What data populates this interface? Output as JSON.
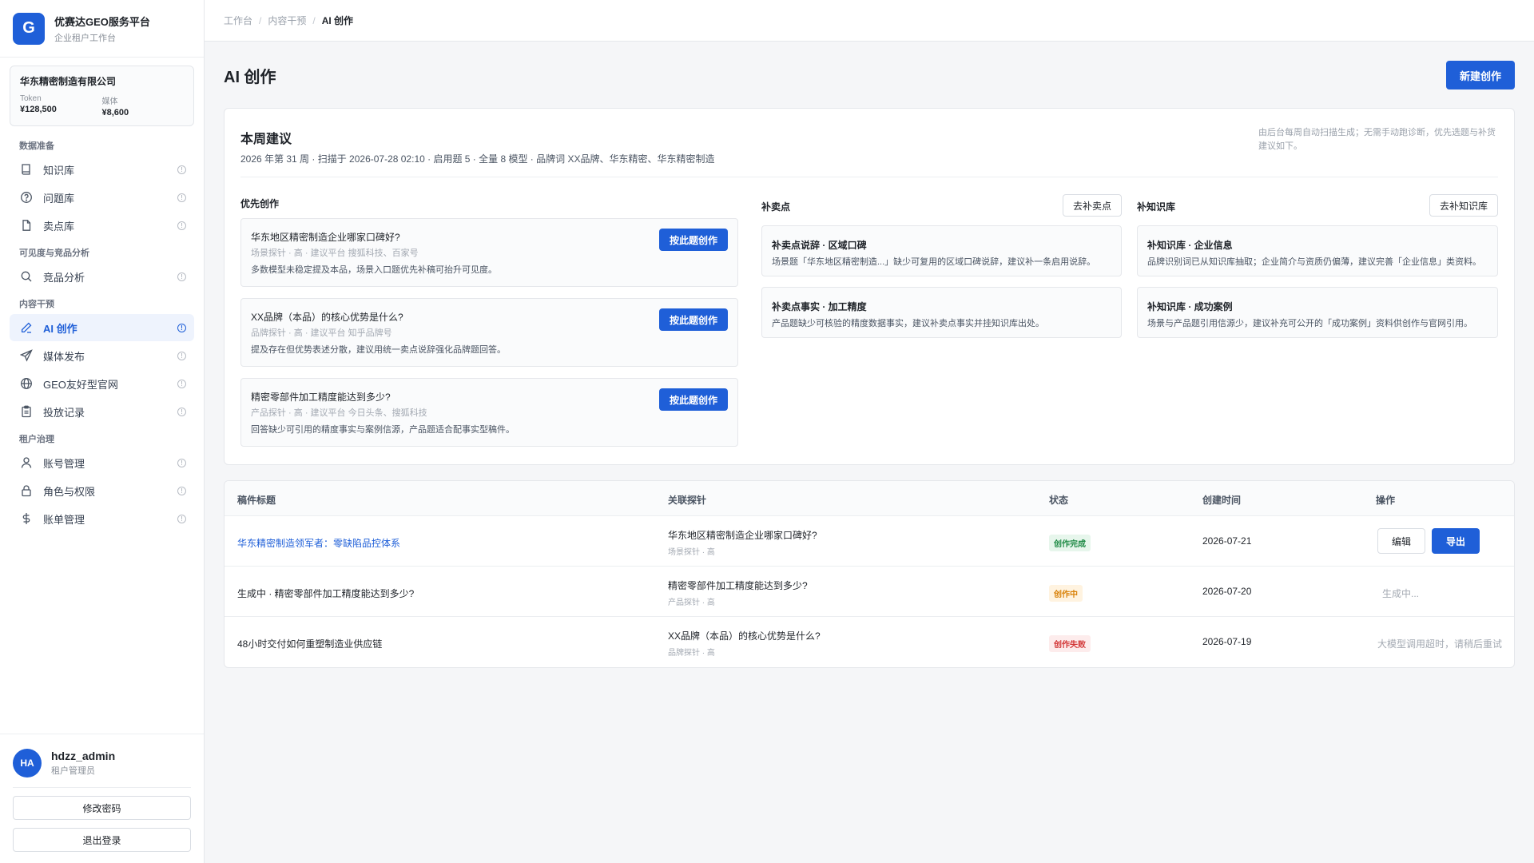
{
  "brand": {
    "logo": "G",
    "name": "优赛达GEO服务平台",
    "subtitle": "企业租户工作台"
  },
  "tenant": {
    "name": "华东精密制造有限公司",
    "stats": [
      {
        "label": "Token",
        "value": "¥128,500"
      },
      {
        "label": "媒体",
        "value": "¥8,600"
      }
    ]
  },
  "nav": {
    "groups": [
      {
        "title": "数据准备",
        "items": [
          {
            "label": "知识库",
            "icon": "book-icon"
          },
          {
            "label": "问题库",
            "icon": "question-circle-icon"
          },
          {
            "label": "卖点库",
            "icon": "file-icon"
          }
        ]
      },
      {
        "title": "可见度与竞品分析",
        "items": [
          {
            "label": "竞品分析",
            "icon": "search-icon"
          }
        ]
      },
      {
        "title": "内容干预",
        "items": [
          {
            "label": "AI 创作",
            "icon": "pen-icon",
            "active": true
          },
          {
            "label": "媒体发布",
            "icon": "send-icon"
          },
          {
            "label": "GEO友好型官网",
            "icon": "globe-icon"
          },
          {
            "label": "投放记录",
            "icon": "clipboard-icon"
          }
        ]
      },
      {
        "title": "租户治理",
        "items": [
          {
            "label": "账号管理",
            "icon": "user-icon"
          },
          {
            "label": "角色与权限",
            "icon": "lock-icon"
          },
          {
            "label": "账单管理",
            "icon": "dollar-icon"
          }
        ]
      }
    ],
    "info_glyph": "!"
  },
  "user": {
    "initials": "HA",
    "name": "hdzz_admin",
    "role": "租户管理员",
    "change_password": "修改密码",
    "logout": "退出登录"
  },
  "breadcrumb": [
    "工作台",
    "内容干预",
    "AI 创作"
  ],
  "breadcrumb_sep": "/",
  "page": {
    "title": "AI 创作",
    "new_button": "新建创作"
  },
  "suggestions": {
    "title": "本周建议",
    "meta": "2026 年第 31 周 · 扫描于 2026-07-28 02:10 · 启用题 5 · 全量 8 模型 · 品牌词 XX品牌、华东精密、华东精密制造",
    "note": "由后台每周自动扫描生成；无需手动跑诊断，优先选题与补货建议如下。",
    "priority": {
      "title": "优先创作",
      "button": "按此题创作",
      "items": [
        {
          "title": "华东地区精密制造企业哪家口碑好?",
          "tags": "场景探针 · 高 · 建议平台 搜狐科技、百家号",
          "desc": "多数模型未稳定提及本品，场景入口题优先补稿可抬升可见度。"
        },
        {
          "title": "XX品牌（本品）的核心优势是什么?",
          "tags": "品牌探针 · 高 · 建议平台 知乎品牌号",
          "desc": "提及存在但优势表述分散，建议用统一卖点说辞强化品牌题回答。"
        },
        {
          "title": "精密零部件加工精度能达到多少?",
          "tags": "产品探针 · 高 · 建议平台 今日头条、搜狐科技",
          "desc": "回答缺少可引用的精度事实与案例信源，产品题适合配事实型稿件。"
        }
      ]
    },
    "selling": {
      "title": "补卖点",
      "button": "去补卖点",
      "items": [
        {
          "title": "补卖点说辞 · 区域口碑",
          "desc": "场景题「华东地区精密制造...」缺少可复用的区域口碑说辞，建议补一条启用说辞。"
        },
        {
          "title": "补卖点事实 · 加工精度",
          "desc": "产品题缺少可核验的精度数据事实，建议补卖点事实并挂知识库出处。"
        }
      ]
    },
    "knowledge": {
      "title": "补知识库",
      "button": "去补知识库",
      "items": [
        {
          "title": "补知识库 · 企业信息",
          "desc": "品牌识别词已从知识库抽取；企业简介与资质仍偏薄，建议完善「企业信息」类资料。"
        },
        {
          "title": "补知识库 · 成功案例",
          "desc": "场景与产品题引用信源少，建议补充可公开的「成功案例」资料供创作与官网引用。"
        }
      ]
    }
  },
  "table": {
    "headers": [
      "稿件标题",
      "关联探针",
      "状态",
      "创建时间",
      "操作"
    ],
    "rows": [
      {
        "title": "华东精密制造领军者：零缺陷品控体系",
        "probe": "华东地区精密制造企业哪家口碑好?",
        "probe_sub": "场景探针 · 高",
        "status": "创作完成",
        "date": "2026-07-21",
        "edit": "编辑",
        "export": "导出"
      },
      {
        "title": "生成中 · 精密零部件加工精度能达到多少?",
        "probe": "精密零部件加工精度能达到多少?",
        "probe_sub": "产品探针 · 高",
        "status": "创作中",
        "date": "2026-07-20",
        "op_text": "生成中..."
      },
      {
        "title": "48小时交付如何重塑制造业供应链",
        "probe": "XX品牌（本品）的核心优势是什么?",
        "probe_sub": "品牌探针 · 高",
        "status": "创作失败",
        "date": "2026-07-19",
        "op_text": "大模型调用超时，请稍后重试"
      }
    ]
  },
  "colors": {
    "primary": "#1f5fd8",
    "success": "#1e8a45",
    "warning": "#d9820a",
    "danger": "#d23535"
  }
}
